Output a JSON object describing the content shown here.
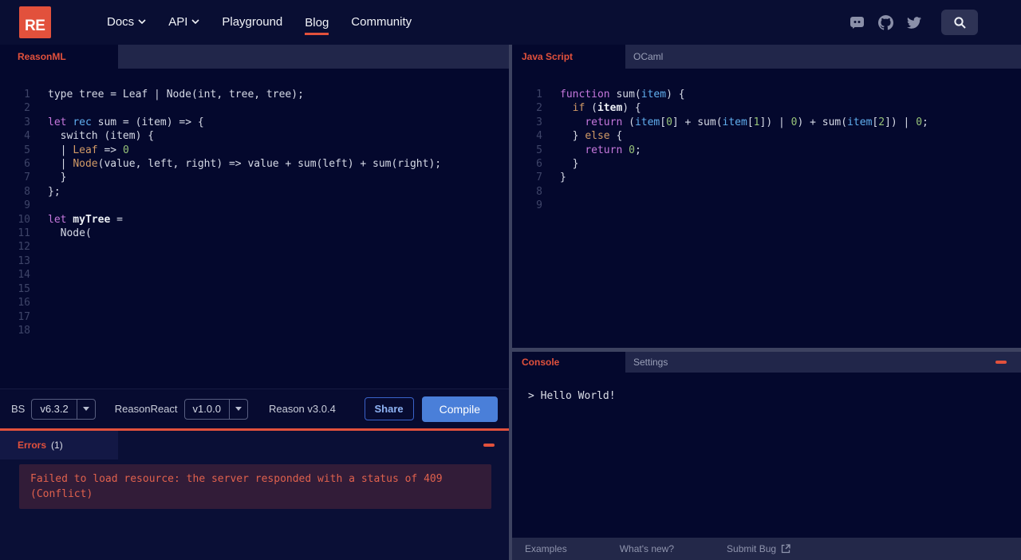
{
  "navbar": {
    "logo_text": "RE",
    "links": [
      {
        "label": "Docs",
        "chevron": true,
        "active": false
      },
      {
        "label": "API",
        "chevron": true,
        "active": false
      },
      {
        "label": "Playground",
        "chevron": false,
        "active": false
      },
      {
        "label": "Blog",
        "chevron": false,
        "active": true
      },
      {
        "label": "Community",
        "chevron": false,
        "active": false
      }
    ],
    "social_icons": [
      "discord-icon",
      "github-icon",
      "twitter-icon"
    ]
  },
  "reason_editor": {
    "tab_label": "ReasonML",
    "total_lines": 18,
    "lines": [
      [
        [
          "w",
          "type tree = Leaf | Node(int, tree, tree);"
        ]
      ],
      [],
      [
        [
          "k",
          "let"
        ],
        [
          "w",
          " "
        ],
        [
          "b",
          "rec"
        ],
        [
          "w",
          " sum = (item) => {"
        ]
      ],
      [
        [
          "w",
          "  switch (item) {"
        ]
      ],
      [
        [
          "w",
          "  | "
        ],
        [
          "o",
          "Leaf"
        ],
        [
          "w",
          " => "
        ],
        [
          "g",
          "0"
        ]
      ],
      [
        [
          "w",
          "  | "
        ],
        [
          "o",
          "Node"
        ],
        [
          "w",
          "(value, left, right) => value + sum(left) + sum(right);"
        ]
      ],
      [
        [
          "w",
          "  }"
        ]
      ],
      [
        [
          "w",
          "};"
        ]
      ],
      [],
      [
        [
          "k",
          "let"
        ],
        [
          "wb",
          " myTree"
        ],
        [
          "w",
          " ="
        ]
      ],
      [
        [
          "w",
          "  Node("
        ]
      ],
      [],
      [],
      [],
      [],
      [],
      [],
      []
    ]
  },
  "output_panel": {
    "tabs": [
      {
        "label": "Java Script",
        "active": true
      },
      {
        "label": "OCaml",
        "active": false
      }
    ],
    "total_lines": 9,
    "lines": [
      [
        [
          "k",
          "function"
        ],
        [
          "w",
          " sum("
        ],
        [
          "b",
          "item"
        ],
        [
          "w",
          ") {"
        ]
      ],
      [
        [
          "w",
          "  "
        ],
        [
          "o",
          "if"
        ],
        [
          "w",
          " ("
        ],
        [
          "wb",
          "item"
        ],
        [
          "w",
          ") {"
        ]
      ],
      [
        [
          "w",
          "    "
        ],
        [
          "k",
          "return"
        ],
        [
          "w",
          " ("
        ],
        [
          "b",
          "item"
        ],
        [
          "w",
          "["
        ],
        [
          "g",
          "0"
        ],
        [
          "w",
          "] + sum("
        ],
        [
          "b",
          "item"
        ],
        [
          "w",
          "["
        ],
        [
          "g",
          "1"
        ],
        [
          "w",
          "]) | "
        ],
        [
          "g",
          "0"
        ],
        [
          "w",
          ") + sum("
        ],
        [
          "b",
          "item"
        ],
        [
          "w",
          "["
        ],
        [
          "g",
          "2"
        ],
        [
          "w",
          "]) | "
        ],
        [
          "g",
          "0"
        ],
        [
          "w",
          ";"
        ]
      ],
      [
        [
          "w",
          "  } "
        ],
        [
          "o",
          "else"
        ],
        [
          "w",
          " {"
        ]
      ],
      [
        [
          "w",
          "    "
        ],
        [
          "k",
          "return"
        ],
        [
          "w",
          " "
        ],
        [
          "g",
          "0"
        ],
        [
          "w",
          ";"
        ]
      ],
      [
        [
          "w",
          "  }"
        ]
      ],
      [
        [
          "w",
          "}"
        ]
      ],
      [],
      []
    ]
  },
  "toolbar": {
    "bs_label": "BS",
    "bs_version": "v6.3.2",
    "reasonreact_label": "ReasonReact",
    "reasonreact_version": "v1.0.0",
    "reason_version_text": "Reason v3.0.4",
    "share_label": "Share",
    "compile_label": "Compile"
  },
  "errors_panel": {
    "tab_label": "Errors",
    "count": "(1)",
    "message": "Failed to load resource: the server responded with a status of 409 (Conflict)"
  },
  "console_panel": {
    "tabs": [
      {
        "label": "Console",
        "active": true
      },
      {
        "label": "Settings",
        "active": false
      }
    ],
    "output": "> Hello World!"
  },
  "footer": {
    "links": [
      {
        "label": "Examples"
      },
      {
        "label": "What's new?"
      },
      {
        "label": "Submit Bug",
        "external_icon": true
      }
    ]
  },
  "colors": {
    "accent": "#e2513c",
    "compile_blue": "#4a7fd9",
    "error_text": "#e0614d",
    "editor_bg": "#04082d"
  }
}
